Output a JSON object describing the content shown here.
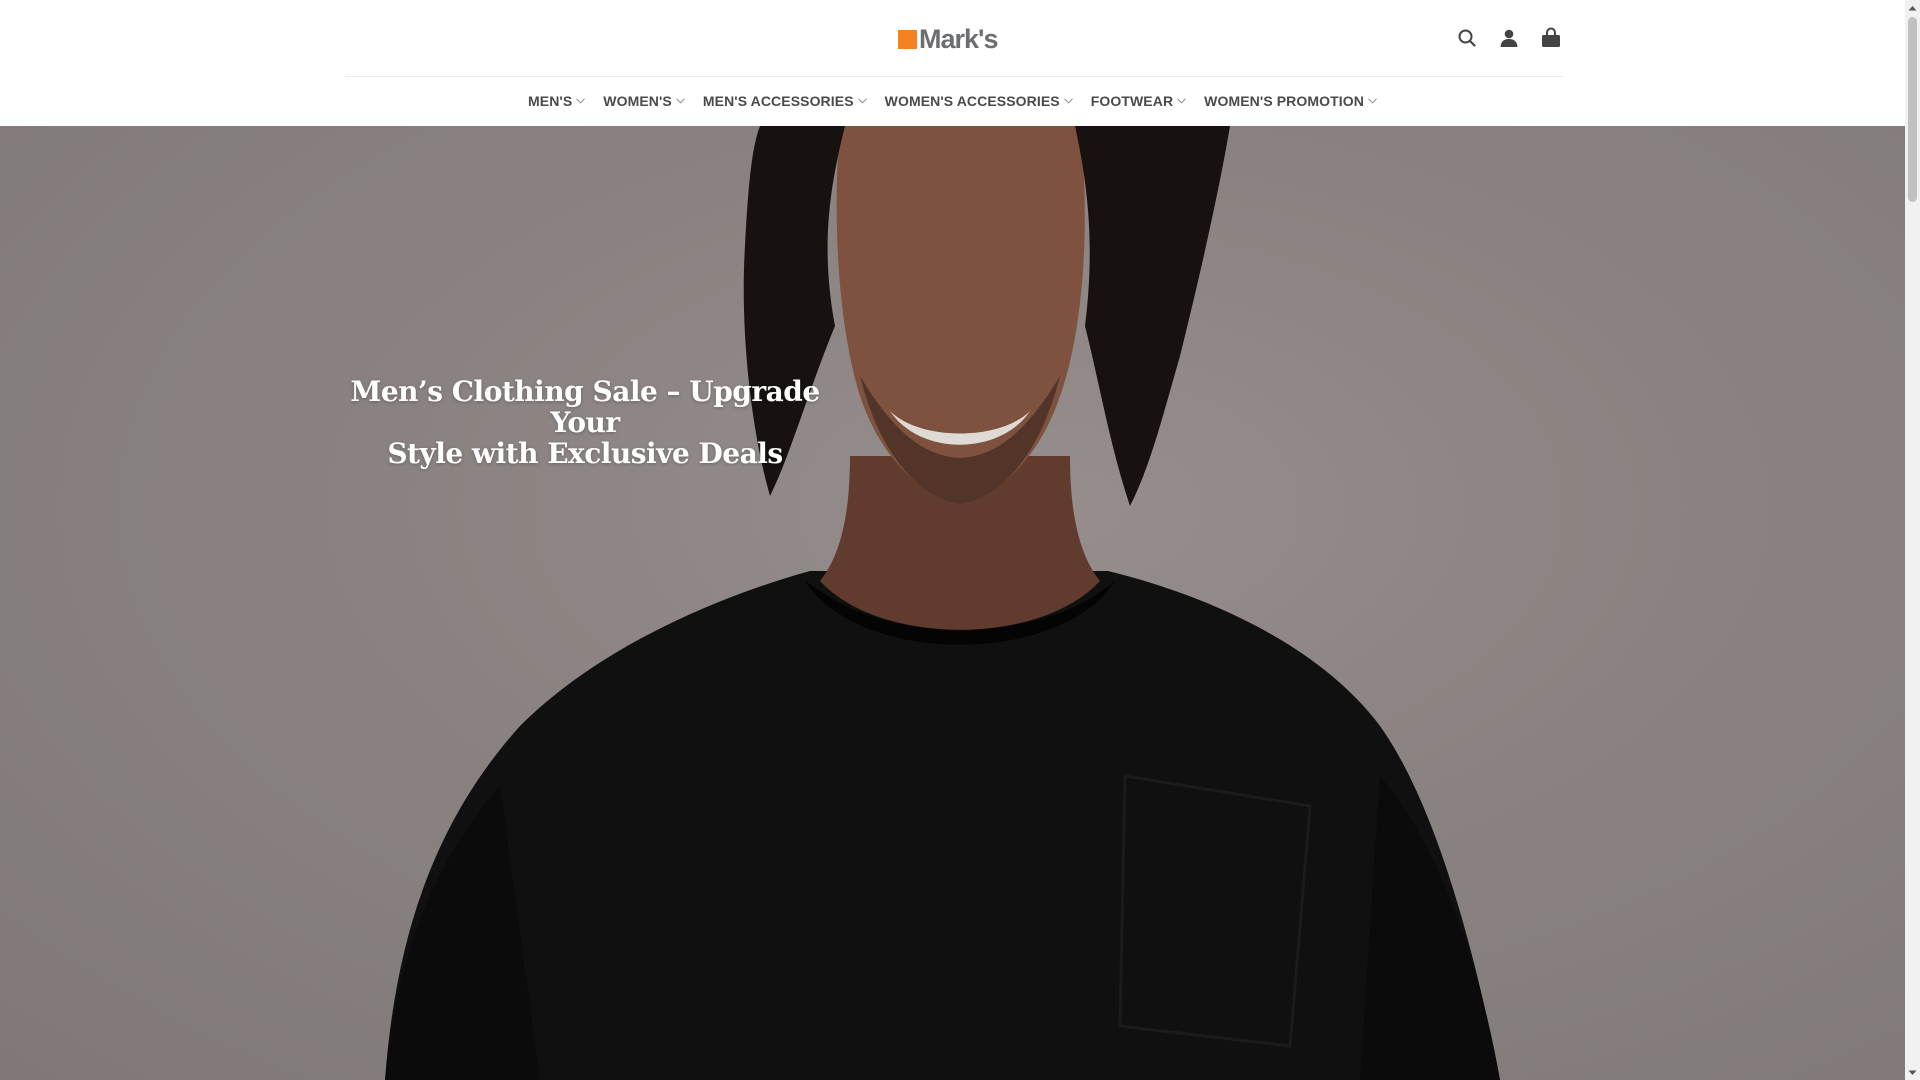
{
  "brand": {
    "name": "Mark's",
    "accent": "#f58220",
    "text_color": "#6d6e71"
  },
  "header": {
    "icons": [
      "search-icon",
      "account-icon",
      "cart-icon"
    ]
  },
  "nav": {
    "items": [
      {
        "label": "MEN'S"
      },
      {
        "label": "WOMEN'S"
      },
      {
        "label": "MEN'S ACCESSORIES"
      },
      {
        "label": "WOMEN'S ACCESSORIES"
      },
      {
        "label": "FOOTWEAR"
      },
      {
        "label": "WOMEN'S PROMOTION"
      }
    ]
  },
  "hero": {
    "title_line1": "Men’s Clothing Sale – Upgrade Your",
    "title_line2": "Style with Exclusive Deals",
    "background": "#968e8c"
  }
}
